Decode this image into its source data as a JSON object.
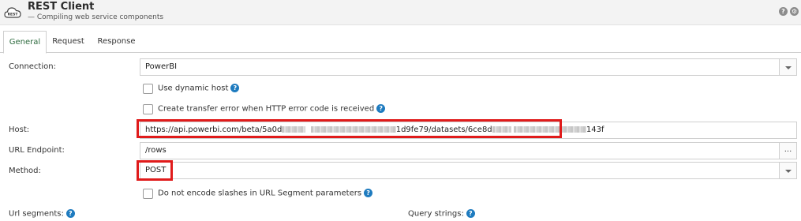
{
  "header": {
    "logo_text": "REST",
    "title": "REST Client",
    "subtitle": "— Compiling web service components",
    "help_icon": "question-icon",
    "settings_icon": "gear-icon"
  },
  "tabs": [
    {
      "label": "General",
      "active": true
    },
    {
      "label": "Request",
      "active": false
    },
    {
      "label": "Response",
      "active": false
    }
  ],
  "form": {
    "connection_label": "Connection:",
    "connection_value": "PowerBI",
    "dynamic_host_label": "Use dynamic host",
    "transfer_error_label": "Create transfer error when HTTP error code is received",
    "host_label": "Host:",
    "host_prefix": "https://api.powerbi.com/beta/5a0d",
    "host_mid": "1d9fe79/datasets/6ce8d",
    "host_suffix": "143f",
    "endpoint_label": "URL Endpoint:",
    "endpoint_value": "/rows",
    "endpoint_button": "...",
    "method_label": "Method:",
    "method_value": "POST",
    "no_encode_label": "Do not encode slashes in URL Segment parameters",
    "url_segments_label": "Url segments:",
    "query_strings_label": "Query strings:"
  },
  "colors": {
    "highlight": "#e01b1b",
    "help": "#1e7bbf",
    "active_tab": "#2e6b3f"
  }
}
